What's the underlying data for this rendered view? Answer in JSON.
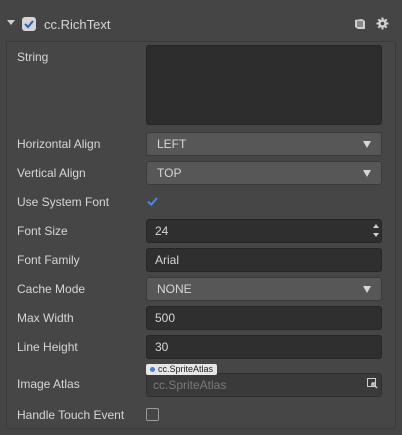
{
  "component": {
    "title": "cc.RichText",
    "enabled": true
  },
  "icons": {
    "collapse": "chevron-down-icon",
    "enable": "checkbox-checked-icon",
    "help": "book-icon",
    "settings": "gear-icon",
    "asset_pick": "asset-locate-icon"
  },
  "properties": {
    "string": {
      "label": "String",
      "value": ""
    },
    "horizontal_align": {
      "label": "Horizontal Align",
      "value": "LEFT"
    },
    "vertical_align": {
      "label": "Vertical Align",
      "value": "TOP"
    },
    "use_system_font": {
      "label": "Use System Font",
      "checked": true
    },
    "font_size": {
      "label": "Font Size",
      "value": "24"
    },
    "font_family": {
      "label": "Font Family",
      "value": "Arial"
    },
    "cache_mode": {
      "label": "Cache Mode",
      "value": "NONE"
    },
    "max_width": {
      "label": "Max Width",
      "value": "500"
    },
    "line_height": {
      "label": "Line Height",
      "value": "30"
    },
    "image_atlas": {
      "label": "Image Atlas",
      "type_tag": "cc.SpriteAtlas",
      "placeholder": "cc.SpriteAtlas"
    },
    "handle_touch_event": {
      "label": "Handle Touch Event",
      "checked": false
    }
  },
  "colors": {
    "background": "#454545",
    "field": "#2f2f2f",
    "select": "#575757",
    "check_accent": "#3c78d8"
  }
}
